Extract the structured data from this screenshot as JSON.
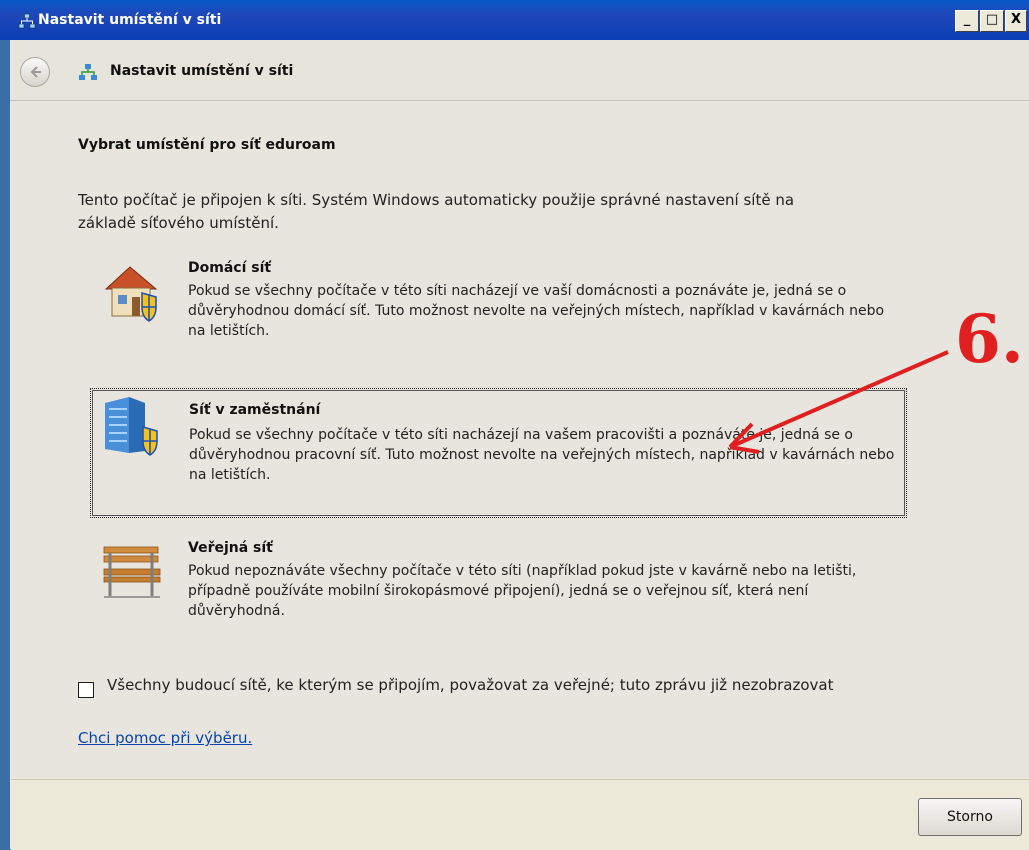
{
  "window": {
    "title": "Nastavit umístění v síti"
  },
  "title_buttons": {
    "minimize": "_",
    "maximize": "□",
    "close": "X"
  },
  "nav": {
    "title": "Nastavit umístění v síti"
  },
  "main": {
    "heading": "Vybrat umístění pro síť eduroam",
    "description": "Tento počítač je připojen k síti. Systém Windows automaticky použije správné nastavení sítě na základě síťového umístění."
  },
  "options": [
    {
      "title": "Domácí síť",
      "description": "Pokud se všechny počítače v této síti nacházejí ve vaší domácnosti a poznáváte je, jedná se o důvěryhodnou domácí síť. Tuto možnost nevolte na veřejných místech, například v kavárnách nebo na letištích.",
      "icon": "home-shield-icon"
    },
    {
      "title": "Síť v zaměstnání",
      "description": "Pokud se všechny počítače v této síti nacházejí na vašem pracovišti a poznáváte je, jedná se o důvěryhodnou pracovní síť. Tuto možnost nevolte na veřejných místech, například v kavárnách nebo na letištích.",
      "icon": "office-building-shield-icon",
      "selected": true
    },
    {
      "title": "Veřejná síť",
      "description": "Pokud nepoznáváte všechny počítače v této síti (například pokud jste v kavárně nebo na letišti, případně používáte mobilní širokopásmové připojení), jedná se o veřejnou síť, která není důvěryhodná.",
      "icon": "park-bench-icon"
    }
  ],
  "footer": {
    "checkbox_label": "Všechny budoucí sítě, ke kterým se připojím, považovat za veřejné; tuto zprávu již nezobrazovat",
    "checkbox_checked": false,
    "help_link": "Chci pomoc při výběru.",
    "cancel_button": "Storno"
  },
  "annotation": {
    "label": "6.",
    "color": "#e02020"
  }
}
